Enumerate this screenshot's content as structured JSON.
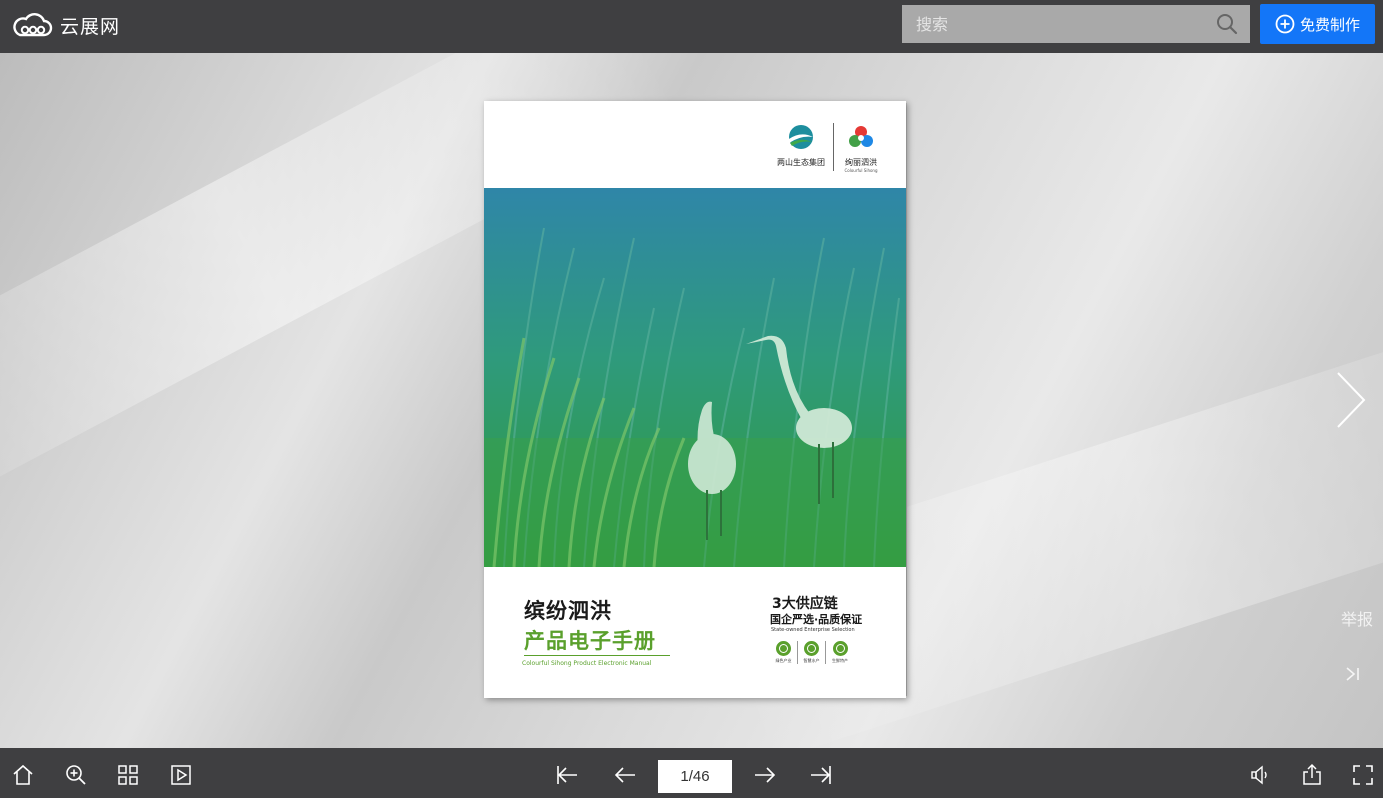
{
  "header": {
    "logo_text": "云展网",
    "search_placeholder": "搜索",
    "create_button_label": "免费制作"
  },
  "cover": {
    "brand_left": {
      "name": "两山生态集团"
    },
    "brand_right": {
      "name": "绚丽泗洪",
      "sub": "Colourful Sihong"
    },
    "title_line1": "缤纷泗洪",
    "title_line2": "产品电子手册",
    "title_en": "Colourful Sihong Product Electronic Manual",
    "feature_line1": "3大供应链",
    "feature_line2": "国企严选·品质保证",
    "feature_en": "State-owned Enterprise Selection",
    "badges": [
      {
        "label": "绿色产业"
      },
      {
        "label": "智慧水产"
      },
      {
        "label": "生鲜特产"
      }
    ]
  },
  "viewer": {
    "report_label": "举报"
  },
  "pagination": {
    "current": "1/46"
  },
  "colors": {
    "bar_bg": "#3f3f41",
    "accent_blue": "#1376f8",
    "cover_green": "#5aa02c"
  }
}
